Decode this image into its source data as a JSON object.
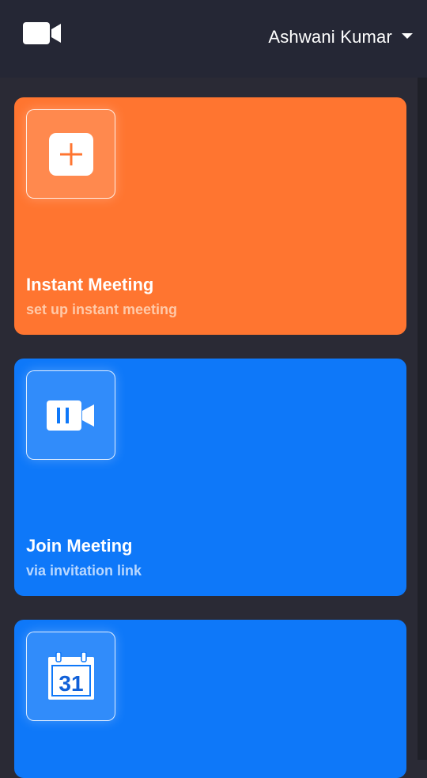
{
  "header": {
    "logo_icon": "video-camera-icon",
    "user_name": "Ashwani Kumar",
    "dropdown_icon": "caret-down-icon"
  },
  "cards": [
    {
      "title": "Instant Meeting",
      "subtitle": "set up instant meeting",
      "icon": "plus-icon",
      "color": "#ff7530"
    },
    {
      "title": "Join Meeting",
      "subtitle": "via invitation link",
      "icon": "video-camera-icon",
      "color": "#0e78f9"
    },
    {
      "title": "",
      "subtitle": "",
      "icon": "calendar-icon",
      "calendar_day": "31",
      "color": "#0e78f9"
    }
  ],
  "colors": {
    "header_bg": "#252735",
    "page_bg": "#2a2a35",
    "orange": "#ff7530",
    "blue": "#0e78f9"
  }
}
